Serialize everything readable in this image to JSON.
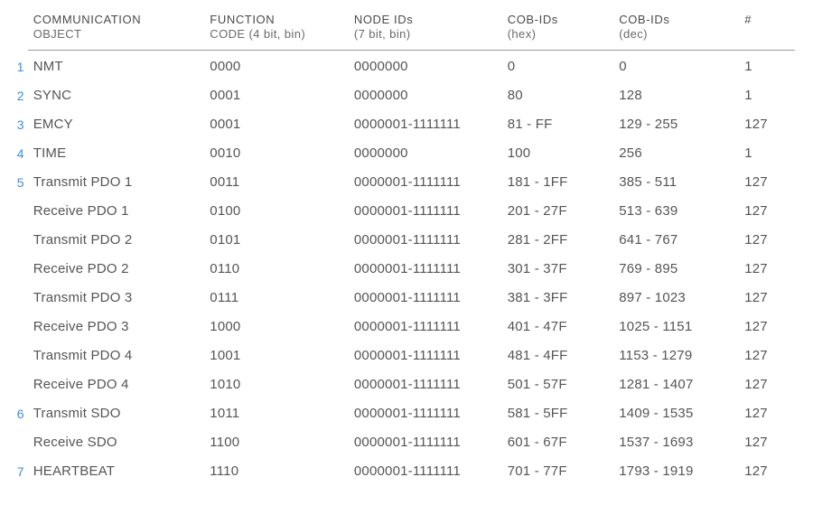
{
  "headers": {
    "num": "",
    "communication_object_top": "COMMUNICATION",
    "communication_object_sub": "OBJECT",
    "function_code_top": "FUNCTION",
    "function_code_sub": "CODE (4 bit, bin)",
    "node_ids_top": "NODE IDs",
    "node_ids_sub": "(7 bit, bin)",
    "cob_hex_top": "COB-IDs",
    "cob_hex_sub": "(hex)",
    "cob_dec_top": "COB-IDs",
    "cob_dec_sub": "(dec)",
    "count": "#"
  },
  "rows": [
    {
      "num": "1",
      "obj": "NMT",
      "func": "0000",
      "node": "0000000",
      "hex": "0",
      "dec": "0",
      "cnt": "1"
    },
    {
      "num": "2",
      "obj": "SYNC",
      "func": "0001",
      "node": "0000000",
      "hex": "80",
      "dec": "128",
      "cnt": "1"
    },
    {
      "num": "3",
      "obj": "EMCY",
      "func": "0001",
      "node": "0000001-1111111",
      "hex": "81 - FF",
      "dec": "129 - 255",
      "cnt": "127"
    },
    {
      "num": "4",
      "obj": "TIME",
      "func": "0010",
      "node": "0000000",
      "hex": "100",
      "dec": "256",
      "cnt": "1"
    },
    {
      "num": "5",
      "obj": "Transmit PDO 1",
      "func": "0011",
      "node": "0000001-1111111",
      "hex": "181 - 1FF",
      "dec": "385 - 511",
      "cnt": "127"
    },
    {
      "num": "",
      "obj": "Receive PDO 1",
      "func": "0100",
      "node": "0000001-1111111",
      "hex": "201 - 27F",
      "dec": "513 - 639",
      "cnt": "127"
    },
    {
      "num": "",
      "obj": "Transmit PDO 2",
      "func": "0101",
      "node": "0000001-1111111",
      "hex": "281 - 2FF",
      "dec": "641 - 767",
      "cnt": "127"
    },
    {
      "num": "",
      "obj": "Receive PDO 2",
      "func": "0110",
      "node": "0000001-1111111",
      "hex": "301 - 37F",
      "dec": "769 - 895",
      "cnt": "127"
    },
    {
      "num": "",
      "obj": "Transmit PDO 3",
      "func": "0111",
      "node": "0000001-1111111",
      "hex": "381 - 3FF",
      "dec": "897 - 1023",
      "cnt": "127"
    },
    {
      "num": "",
      "obj": "Receive PDO 3",
      "func": "1000",
      "node": "0000001-1111111",
      "hex": "401 - 47F",
      "dec": "1025 - 1151",
      "cnt": "127"
    },
    {
      "num": "",
      "obj": "Transmit PDO 4",
      "func": "1001",
      "node": "0000001-1111111",
      "hex": "481 - 4FF",
      "dec": "1153 - 1279",
      "cnt": "127"
    },
    {
      "num": "",
      "obj": "Receive PDO 4",
      "func": "1010",
      "node": "0000001-1111111",
      "hex": "501 - 57F",
      "dec": "1281 - 1407",
      "cnt": "127"
    },
    {
      "num": "6",
      "obj": "Transmit SDO",
      "func": "1011",
      "node": "0000001-1111111",
      "hex": "581 - 5FF",
      "dec": "1409 - 1535",
      "cnt": "127"
    },
    {
      "num": "",
      "obj": "Receive SDO",
      "func": "1100",
      "node": "0000001-1111111",
      "hex": "601 - 67F",
      "dec": "1537 - 1693",
      "cnt": "127"
    },
    {
      "num": "7",
      "obj": "HEARTBEAT",
      "func": "1110",
      "node": "0000001-1111111",
      "hex": "701 - 77F",
      "dec": "1793 - 1919",
      "cnt": "127"
    }
  ]
}
